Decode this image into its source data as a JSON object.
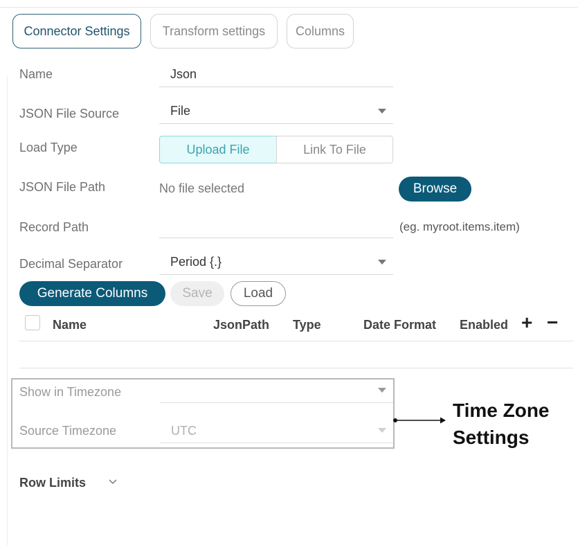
{
  "tabs": [
    {
      "label": "Connector Settings",
      "active": true
    },
    {
      "label": "Transform settings",
      "active": false
    },
    {
      "label": "Columns",
      "active": false
    }
  ],
  "form": {
    "name": {
      "label": "Name",
      "value": "Json"
    },
    "file_source": {
      "label": "JSON File Source",
      "value": "File"
    },
    "load_type": {
      "label": "Load Type",
      "options": [
        "Upload File",
        "Link To File"
      ],
      "selected": "Upload File"
    },
    "file_path": {
      "label": "JSON File Path",
      "value": "No file selected",
      "browse": "Browse"
    },
    "record_path": {
      "label": "Record Path",
      "value": "",
      "hint": "(eg. myroot.items.item)"
    },
    "decimal_separator": {
      "label": "Decimal Separator",
      "value": "Period {.}"
    }
  },
  "actions": {
    "generate": "Generate Columns",
    "save": "Save",
    "load": "Load"
  },
  "columns_table": {
    "headers": [
      "Name",
      "JsonPath",
      "Type",
      "Date Format",
      "Enabled"
    ],
    "add_symbol": "+",
    "remove_symbol": "−"
  },
  "timezone": {
    "show_label": "Show in Timezone",
    "show_value": "",
    "source_label": "Source Timezone",
    "source_value": "UTC"
  },
  "annotation": {
    "line1": "Time Zone",
    "line2": "Settings"
  },
  "row_limits": {
    "label": "Row Limits"
  },
  "colors": {
    "primary": "#0b5a78",
    "accent_light": "#e5fafa",
    "accent_text": "#3aa3b0"
  }
}
